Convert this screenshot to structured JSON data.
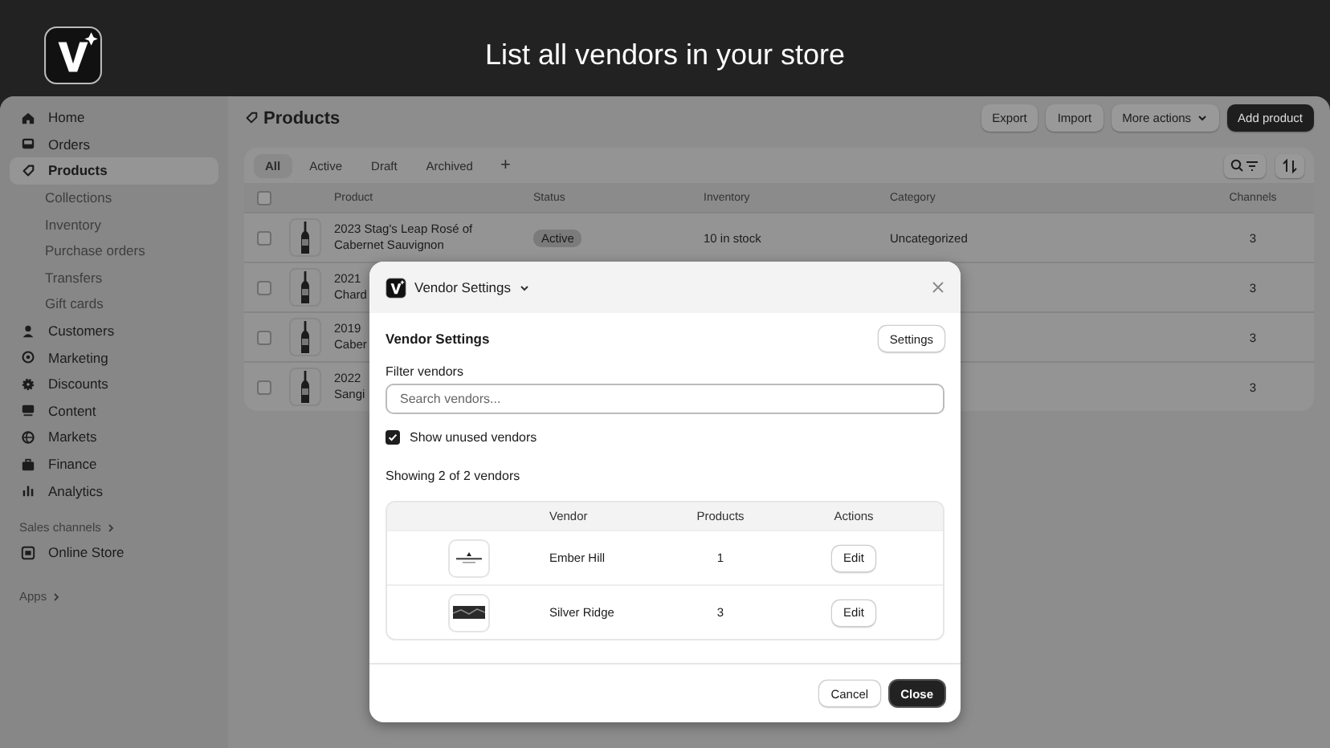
{
  "header": {
    "title": "List all vendors in your store"
  },
  "sidebar": {
    "items": [
      {
        "label": "Home",
        "kind": "main",
        "selected": false
      },
      {
        "label": "Orders",
        "kind": "main",
        "selected": false
      },
      {
        "label": "Products",
        "kind": "main",
        "selected": true
      },
      {
        "label": "Collections",
        "kind": "sub",
        "selected": false
      },
      {
        "label": "Inventory",
        "kind": "sub",
        "selected": false
      },
      {
        "label": "Purchase orders",
        "kind": "sub",
        "selected": false
      },
      {
        "label": "Transfers",
        "kind": "sub",
        "selected": false
      },
      {
        "label": "Gift cards",
        "kind": "sub",
        "selected": false
      },
      {
        "label": "Customers",
        "kind": "main",
        "selected": false
      },
      {
        "label": "Marketing",
        "kind": "main",
        "selected": false
      },
      {
        "label": "Discounts",
        "kind": "main",
        "selected": false
      },
      {
        "label": "Content",
        "kind": "main",
        "selected": false
      },
      {
        "label": "Markets",
        "kind": "main",
        "selected": false
      },
      {
        "label": "Finance",
        "kind": "main",
        "selected": false
      },
      {
        "label": "Analytics",
        "kind": "main",
        "selected": false
      }
    ],
    "sales_channels": {
      "label": "Sales channels",
      "items": [
        {
          "label": "Online Store",
          "selected": false
        }
      ]
    },
    "apps": {
      "label": "Apps"
    }
  },
  "page": {
    "title": "Products",
    "actions": [
      {
        "label": "Export",
        "kind": "plain"
      },
      {
        "label": "Import",
        "kind": "plain"
      },
      {
        "label": "More actions",
        "kind": "menu"
      },
      {
        "label": "Add product",
        "kind": "primary"
      }
    ],
    "tabs": [
      {
        "label": "All",
        "selected": true
      },
      {
        "label": "Active",
        "selected": false
      },
      {
        "label": "Draft",
        "selected": false
      },
      {
        "label": "Archived",
        "selected": false
      }
    ],
    "add_tab": "+",
    "table": {
      "all_checked": false,
      "columns": [
        "Product",
        "Status",
        "Inventory",
        "Category",
        "Channels"
      ],
      "rows": [
        {
          "checked": false,
          "product_lines": [
            "2023 Stag's Leap Rosé of",
            "Cabernet Sauvignon"
          ],
          "status": "Active",
          "inventory": "10 in stock",
          "category": "Uncategorized",
          "channels": "3"
        },
        {
          "checked": false,
          "product_lines": [
            "2021",
            "Chard"
          ],
          "channels": "3"
        },
        {
          "checked": false,
          "product_lines": [
            "2019",
            "Caber"
          ],
          "channels": "3"
        },
        {
          "checked": false,
          "product_lines": [
            "2022",
            "Sangi"
          ],
          "channels": "3"
        }
      ]
    }
  },
  "dialog": {
    "title": "Vendor Settings",
    "heading": "Vendor Settings",
    "settings_button": "Settings",
    "filter_label": "Filter vendors",
    "search": {
      "placeholder": "Search vendors..."
    },
    "show_unused": {
      "label": "Show unused vendors",
      "checked": true
    },
    "summary": "Showing 2 of 2 vendors",
    "columns": [
      "Vendor",
      "Products",
      "Actions"
    ],
    "vendors": [
      {
        "name": "Ember Hill",
        "products": "1",
        "action": "Edit"
      },
      {
        "name": "Silver Ridge",
        "products": "3",
        "action": "Edit"
      }
    ],
    "buttons": [
      {
        "label": "Cancel",
        "kind": "secondary"
      },
      {
        "label": "Close",
        "kind": "primary"
      }
    ]
  }
}
